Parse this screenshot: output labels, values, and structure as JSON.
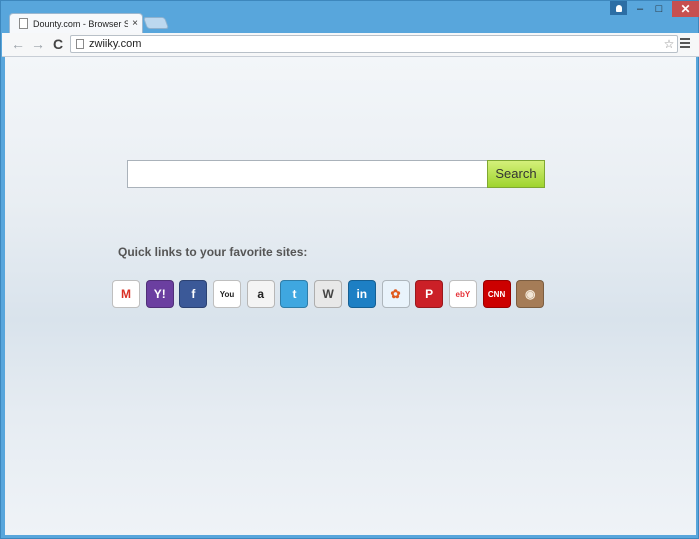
{
  "browser": {
    "tab_title": "Dounty.com - Browser Se",
    "tab_close": "×",
    "url": "zwiiky.com",
    "back_icon": "←",
    "forward_icon": "→",
    "reload_icon": "C",
    "star_icon": "☆",
    "minimize": "–",
    "maximize": "□",
    "close": "✕"
  },
  "search": {
    "input_value": "",
    "button_label": "Search"
  },
  "quick_links": {
    "title": "Quick links to your favorite sites:",
    "sites": [
      {
        "name": "gmail",
        "glyph": "M",
        "bg": "#ffffff",
        "fg": "#d93025"
      },
      {
        "name": "yahoo",
        "glyph": "Y!",
        "bg": "#6b3fa0",
        "fg": "#ffffff"
      },
      {
        "name": "facebook",
        "glyph": "f",
        "bg": "#3b5998",
        "fg": "#ffffff"
      },
      {
        "name": "youtube",
        "glyph": "You",
        "bg": "#ffffff",
        "fg": "#222222"
      },
      {
        "name": "amazon",
        "glyph": "a",
        "bg": "#f4f4f4",
        "fg": "#222222"
      },
      {
        "name": "twitter",
        "glyph": "t",
        "bg": "#3fa7e0",
        "fg": "#ffffff"
      },
      {
        "name": "wikipedia",
        "glyph": "W",
        "bg": "#e8e8e8",
        "fg": "#444444"
      },
      {
        "name": "linkedin",
        "glyph": "in",
        "bg": "#1d7fc4",
        "fg": "#ffffff"
      },
      {
        "name": "msn",
        "glyph": "✿",
        "bg": "#e9f3fb",
        "fg": "#e05a1d"
      },
      {
        "name": "pinterest",
        "glyph": "P",
        "bg": "#cb2027",
        "fg": "#ffffff"
      },
      {
        "name": "ebay",
        "glyph": "ebY",
        "bg": "#ffffff",
        "fg": "#e53238"
      },
      {
        "name": "cnn",
        "glyph": "CNN",
        "bg": "#cc0000",
        "fg": "#ffffff"
      },
      {
        "name": "instagram",
        "glyph": "◉",
        "bg": "#a57c57",
        "fg": "#f2e6d6"
      }
    ]
  },
  "colors": {
    "frame": "#58a6dc",
    "search_button": "#9fd42e",
    "close_button": "#c75050"
  }
}
